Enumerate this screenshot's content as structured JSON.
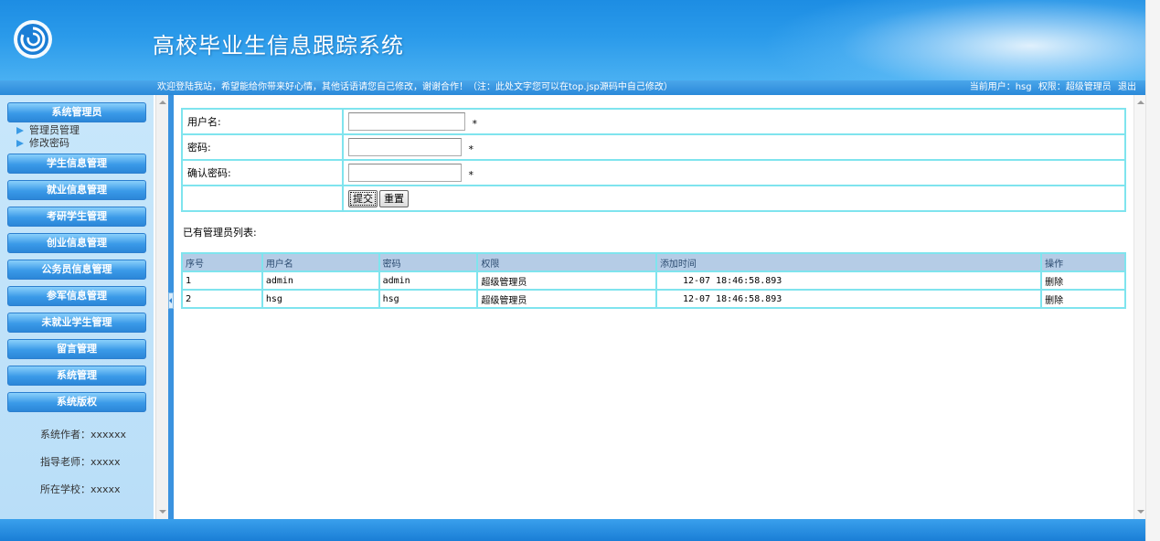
{
  "header": {
    "title": "高校毕业生信息跟踪系统",
    "welcome": "欢迎登陆我站，希望能给你带来好心情，其他话语请您自己修改，谢谢合作！（注：此处文字您可以在top.jsp源码中自己修改）",
    "current_user_label": "当前用户：",
    "current_user": "hsg",
    "role_label": "权限：",
    "role": "超级管理员",
    "logout": "退出"
  },
  "sidebar": {
    "groups": [
      {
        "label": "系统管理员",
        "items": [
          "管理员管理",
          "修改密码"
        ]
      },
      {
        "label": "学生信息管理"
      },
      {
        "label": "就业信息管理"
      },
      {
        "label": "考研学生管理"
      },
      {
        "label": "创业信息管理"
      },
      {
        "label": "公务员信息管理"
      },
      {
        "label": "参军信息管理"
      },
      {
        "label": "未就业学生管理"
      },
      {
        "label": "留言管理"
      },
      {
        "label": "系统管理"
      },
      {
        "label": "系统版权"
      }
    ],
    "credits": {
      "author": "系统作者：xxxxxx",
      "teacher": "指导老师：xxxxx",
      "school": "所在学校：xxxxx"
    }
  },
  "form": {
    "username_label": "用户名:",
    "password_label": "密码:",
    "confirm_label": "确认密码:",
    "username_value": "",
    "password_value": "",
    "confirm_value": "",
    "required_mark": "*",
    "submit_label": "提交",
    "reset_label": "重置"
  },
  "list": {
    "title": "已有管理员列表:",
    "columns": [
      "序号",
      "用户名",
      "密码",
      "权限",
      "添加时间",
      "操作"
    ],
    "rows": [
      [
        "1",
        "admin",
        "admin",
        "超级管理员",
        "12-07 18:46:58.893",
        "删除"
      ],
      [
        "2",
        "hsg",
        "hsg",
        "超级管理员",
        "12-07 18:46:58.893",
        "删除"
      ]
    ]
  },
  "colors": {
    "header_blue": "#1d8de3",
    "menu_blue": "#3a9ae8",
    "table_border": "#7fe4ee",
    "table_header_bg": "#b5cce6"
  }
}
